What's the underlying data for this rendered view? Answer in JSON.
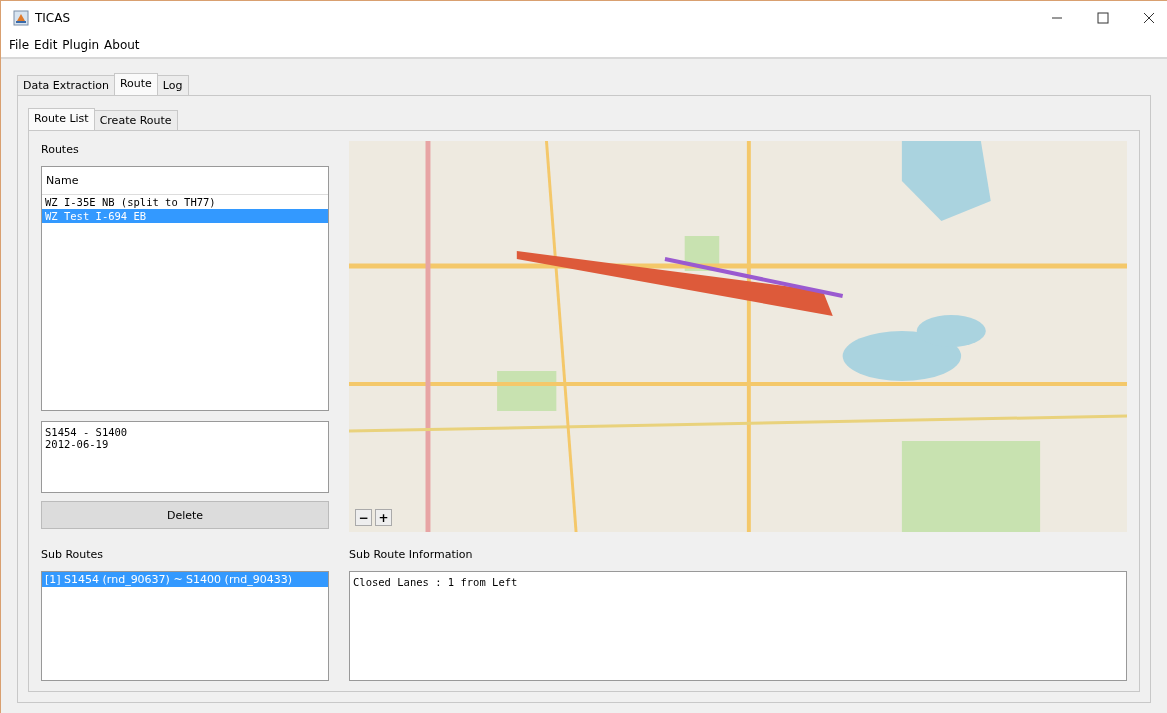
{
  "window": {
    "title": "TICAS"
  },
  "menu": [
    "File",
    "Edit",
    "Plugin",
    "About"
  ],
  "tabs": [
    {
      "label": "Data Extraction",
      "selected": false
    },
    {
      "label": "Route",
      "selected": true
    },
    {
      "label": "Log",
      "selected": false
    }
  ],
  "subtabs": [
    {
      "label": "Route List",
      "selected": true
    },
    {
      "label": "Create Route",
      "selected": false
    }
  ],
  "routes": {
    "label": "Routes",
    "column": "Name",
    "rows": [
      {
        "name": "WZ I-35E NB (split to TH77)",
        "selected": false
      },
      {
        "name": "WZ Test I-694 EB",
        "selected": true
      }
    ]
  },
  "route_info": [
    "S1454 - S1400",
    "2012-06-19"
  ],
  "delete_button": "Delete",
  "map": {
    "kind": "picture",
    "zoom_buttons": [
      "−",
      "+"
    ]
  },
  "sub_routes": {
    "label": "Sub Routes",
    "items": [
      {
        "text": "[1] S1454 (rnd_90637) ~ S1400 (rnd_90433)",
        "selected": true
      }
    ]
  },
  "sub_route_info": {
    "label": "Sub Route Information",
    "text": "Closed Lanes : 1 from Left"
  }
}
